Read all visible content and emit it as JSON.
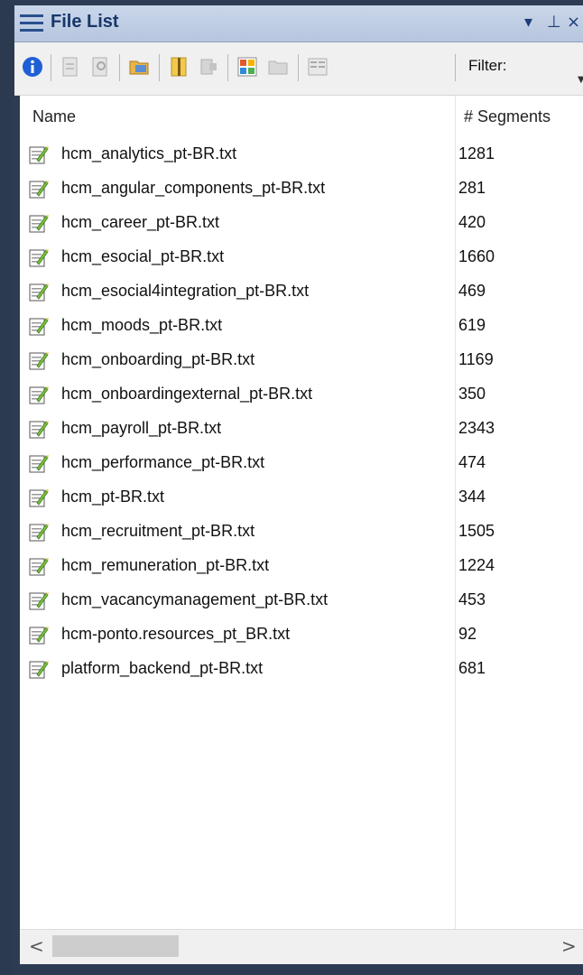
{
  "panel": {
    "title": "File List"
  },
  "titlebar_buttons": [
    "▾",
    "⊥",
    "×"
  ],
  "toolbar": {
    "filter_label": "Filter:",
    "icons": [
      "info-icon",
      "new-document-icon",
      "search-document-icon",
      "open-folder-icon",
      "zip-icon",
      "export-icon",
      "grid-view-icon",
      "folder-icon",
      "split-view-icon"
    ]
  },
  "columns": {
    "name": "Name",
    "segments": "# Segments"
  },
  "files": [
    {
      "name": "hcm_analytics_pt-BR.txt",
      "segments": "1281"
    },
    {
      "name": "hcm_angular_components_pt-BR.txt",
      "segments": "281"
    },
    {
      "name": "hcm_career_pt-BR.txt",
      "segments": "420"
    },
    {
      "name": "hcm_esocial_pt-BR.txt",
      "segments": "1660"
    },
    {
      "name": "hcm_esocial4integration_pt-BR.txt",
      "segments": "469"
    },
    {
      "name": "hcm_moods_pt-BR.txt",
      "segments": "619"
    },
    {
      "name": "hcm_onboarding_pt-BR.txt",
      "segments": "1169"
    },
    {
      "name": "hcm_onboardingexternal_pt-BR.txt",
      "segments": "350"
    },
    {
      "name": "hcm_payroll_pt-BR.txt",
      "segments": "2343"
    },
    {
      "name": "hcm_performance_pt-BR.txt",
      "segments": "474"
    },
    {
      "name": "hcm_pt-BR.txt",
      "segments": "344"
    },
    {
      "name": "hcm_recruitment_pt-BR.txt",
      "segments": "1505"
    },
    {
      "name": "hcm_remuneration_pt-BR.txt",
      "segments": "1224"
    },
    {
      "name": "hcm_vacancymanagement_pt-BR.txt",
      "segments": "453"
    },
    {
      "name": "hcm-ponto.resources_pt_BR.txt",
      "segments": "92"
    },
    {
      "name": "platform_backend_pt-BR.txt",
      "segments": "681"
    }
  ],
  "scrollbar": {
    "left_arrow": "<",
    "right_arrow": ">"
  },
  "colors": {
    "title_bg": "#c9d6ea",
    "title_text": "#18366b",
    "frame": "#2d3c52"
  }
}
